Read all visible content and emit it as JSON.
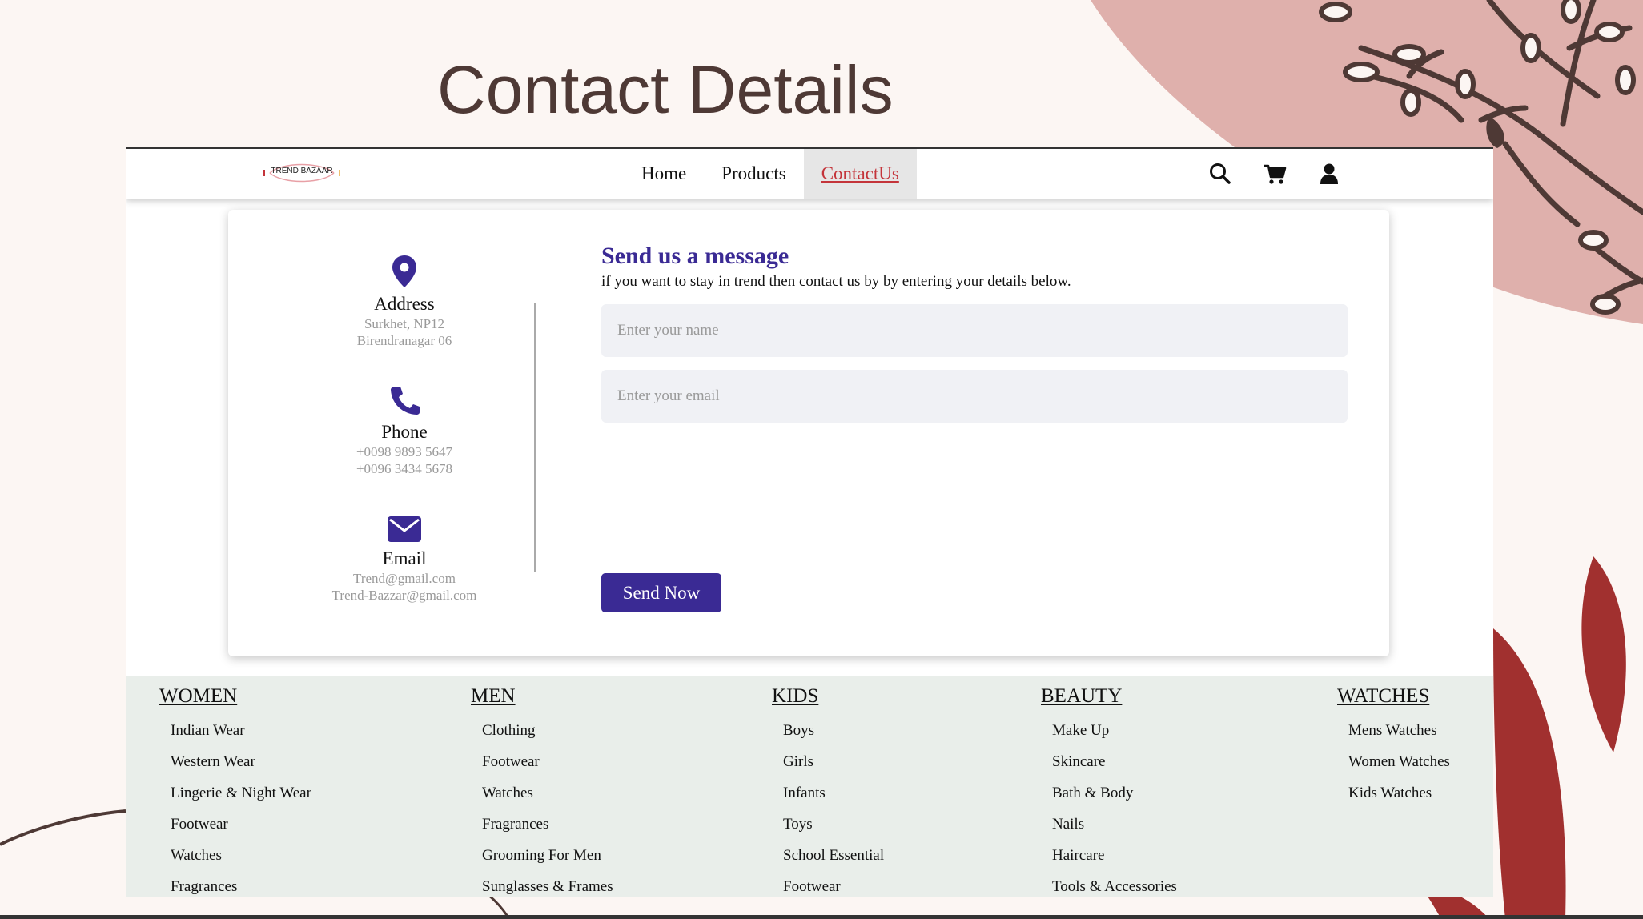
{
  "slide": {
    "title": "Contact Details"
  },
  "navbar": {
    "logo_text": "TREND BAZAAR",
    "links": [
      {
        "label": "Home",
        "active": false
      },
      {
        "label": "Products",
        "active": false
      },
      {
        "label": "ContactUs",
        "active": true
      }
    ],
    "icons": [
      "search-icon",
      "cart-icon",
      "user-icon"
    ]
  },
  "contact_info": {
    "address": {
      "title": "Address",
      "line1": "Surkhet, NP12",
      "line2": "Birendranagar 06",
      "icon": "map-pin-icon"
    },
    "phone": {
      "title": "Phone",
      "line1": "+0098 9893 5647",
      "line2": "+0096 3434 5678",
      "icon": "phone-icon"
    },
    "email": {
      "title": "Email",
      "line1": "Trend@gmail.com",
      "line2": "Trend-Bazzar@gmail.com",
      "icon": "envelope-icon"
    }
  },
  "form": {
    "title": "Send us a message",
    "subtitle": "if you want to stay in trend then contact us by by entering your details below.",
    "name_placeholder": "Enter your name",
    "email_placeholder": "Enter your email",
    "name_value": "",
    "email_value": "",
    "submit_label": "Send Now"
  },
  "footer": {
    "columns": [
      {
        "heading": "WOMEN",
        "items": [
          "Indian Wear",
          "Western Wear",
          "Lingerie & Night Wear",
          "Footwear",
          "Watches",
          "Fragrances"
        ]
      },
      {
        "heading": "MEN",
        "items": [
          "Clothing",
          "Footwear",
          "Watches",
          "Fragrances",
          "Grooming For Men",
          "Sunglasses & Frames"
        ]
      },
      {
        "heading": "KIDS",
        "items": [
          "Boys",
          "Girls",
          "Infants",
          "Toys",
          "School Essential",
          "Footwear"
        ]
      },
      {
        "heading": "BEAUTY",
        "items": [
          "Make Up",
          "Skincare",
          "Bath & Body",
          "Nails",
          "Haircare",
          "Tools & Accessories"
        ]
      },
      {
        "heading": "WATCHES",
        "items": [
          "Mens Watches",
          "Women Watches",
          "Kids Watches"
        ]
      }
    ]
  },
  "colors": {
    "accent": "#3a2a94",
    "active_link": "#c4343a",
    "slide_background": "#fcf6f3",
    "slide_title": "#4e3935",
    "pink_shape": "#dfb0ac",
    "branch": "#4e3935",
    "leaves": "#a1302f",
    "footer_background": "#e9eeea"
  }
}
